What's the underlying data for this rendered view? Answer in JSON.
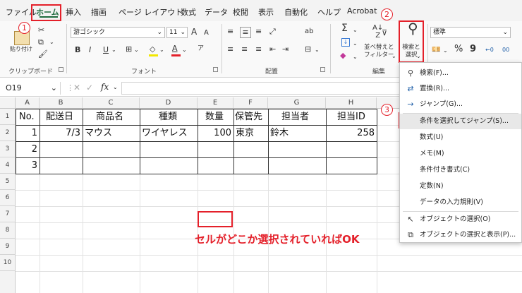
{
  "menu": [
    "ファイル",
    "ホーム",
    "挿入",
    "描画",
    "ページ レイアウト",
    "数式",
    "データ",
    "校閲",
    "表示",
    "自動化",
    "ヘルプ",
    "Acrobat"
  ],
  "ribbon": {
    "paste_label": "貼り付け",
    "group_clipboard": "クリップボード",
    "group_font": "フォント",
    "group_alignment": "配置",
    "group_edit": "編集",
    "font_name": "游ゴシック",
    "font_size": "11",
    "font_a_large": "A",
    "font_a_small": "A",
    "bold": "B",
    "italic": "I",
    "underline": "U",
    "wrap_glyph": "ab",
    "sort_filter_label": "並べ替えと\nフィルター",
    "find_select_label": "検索と\n選択",
    "number_format": "標準",
    "percent": "%",
    "comma": "9",
    "dec_inc": "←0",
    "dec_dec": "00"
  },
  "formula_bar": {
    "name_box": "O19",
    "fx": "fx"
  },
  "columns": [
    "A",
    "B",
    "C",
    "D",
    "E",
    "F",
    "G",
    "H"
  ],
  "rows": [
    "1",
    "2",
    "3",
    "4",
    "5",
    "6",
    "7",
    "8",
    "9",
    "10"
  ],
  "table": {
    "headers": [
      "No.",
      "配送日",
      "商品名",
      "種類",
      "数量",
      "保管先",
      "担当者",
      "担当ID"
    ],
    "row1": [
      "1",
      "7/3",
      "マウス",
      "ワイヤレス",
      "100",
      "東京",
      "鈴木",
      "258"
    ],
    "row2_no": "2",
    "row3_no": "3"
  },
  "dropdown": [
    {
      "icon": "search-icon",
      "label": "検索(F)..."
    },
    {
      "icon": "replace-icon",
      "label": "置換(R)..."
    },
    {
      "icon": "arrow-right-icon",
      "label": "ジャンプ(G)..."
    },
    {
      "icon": "",
      "label": "条件を選択してジャンプ(S)..."
    },
    {
      "icon": "",
      "label": "数式(U)"
    },
    {
      "icon": "",
      "label": "メモ(M)"
    },
    {
      "icon": "",
      "label": "条件付き書式(C)"
    },
    {
      "icon": "",
      "label": "定数(N)"
    },
    {
      "icon": "",
      "label": "データの入力規則(V)"
    },
    {
      "icon": "cursor-icon",
      "label": "オブジェクトの選択(O)"
    },
    {
      "icon": "selection-pane-icon",
      "label": "オブジェクトの選択と表示(P)..."
    }
  ],
  "annotations": {
    "step1": "1",
    "step2": "2",
    "step3": "3",
    "note": "セルがどこか選択されていればOK"
  },
  "colors": {
    "accent_green": "#1e6b3d",
    "annotation_red": "#e4202a"
  }
}
